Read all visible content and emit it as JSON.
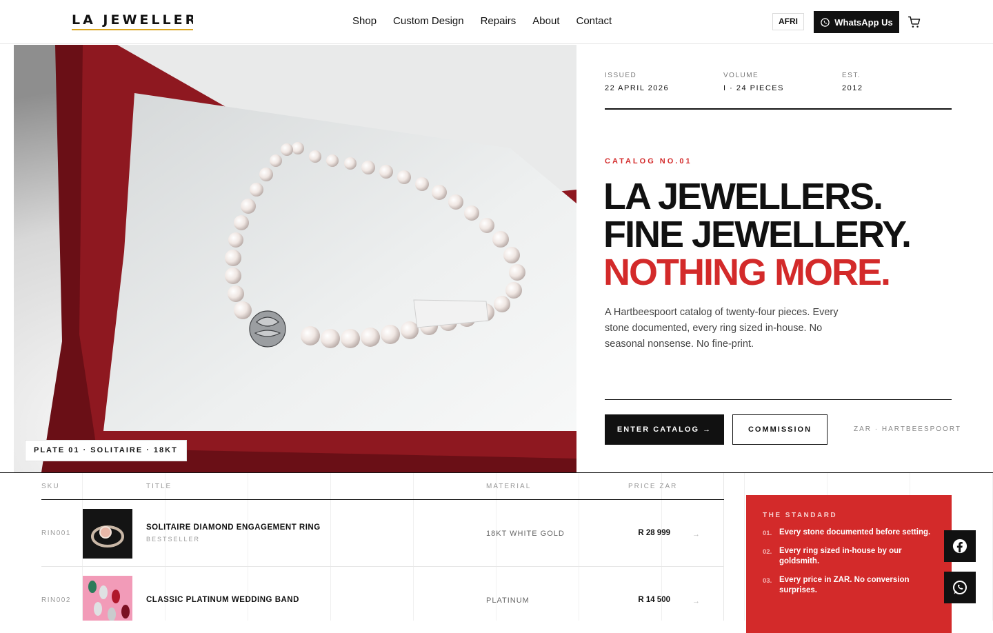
{
  "header": {
    "logo": "LA JEWELLERS",
    "nav": [
      "Shop",
      "Custom Design",
      "Repairs",
      "About",
      "Contact"
    ],
    "language": "AFRI",
    "whatsapp_label": "WhatsApp Us",
    "cart_icon": "cart-icon"
  },
  "hero": {
    "plate_label": "PLATE 01 · SOLITAIRE · 18KT",
    "meta": [
      {
        "key": "ISSUED",
        "value": "22 APRIL 2026"
      },
      {
        "key": "VOLUME",
        "value": "I · 24 PIECES"
      },
      {
        "key": "EST.",
        "value": "2012"
      }
    ],
    "eyebrow": "CATALOG NO.01",
    "headline_line1": "LA JEWELLERS.",
    "headline_line2": "FINE JEWELLERY.",
    "headline_line3": "NOTHING MORE.",
    "lede": "A Hartbeespoort catalog of twenty-four pieces. Every stone documented, every ring sized in-house. No seasonal nonsense. No fine-print.",
    "primary_cta": "ENTER CATALOG →",
    "secondary_cta": "COMMISSION",
    "locale": "ZAR · HARTBEESPOORT"
  },
  "catalog": {
    "columns": {
      "sku": "SKU",
      "title": "TITLE",
      "material": "MATERIAL",
      "price": "PRICE ZAR"
    },
    "rows": [
      {
        "sku": "RIN001",
        "title": "SOLITAIRE DIAMOND ENGAGEMENT RING",
        "subtitle": "BESTSELLER",
        "material": "18KT WHITE GOLD",
        "price": "R 28 999",
        "arrow": "→"
      },
      {
        "sku": "RIN002",
        "title": "CLASSIC PLATINUM WEDDING BAND",
        "subtitle": "",
        "material": "PLATINUM",
        "price": "R 14 500",
        "arrow": "→"
      }
    ]
  },
  "standard": {
    "title": "THE STANDARD",
    "items": [
      {
        "num": "01.",
        "text": "Every stone documented before setting."
      },
      {
        "num": "02.",
        "text": "Every ring sized in-house by our goldsmith."
      },
      {
        "num": "03.",
        "text": "Every price in ZAR. No conversion surprises."
      }
    ]
  },
  "floating": {
    "facebook_icon": "facebook-icon",
    "whatsapp_icon": "whatsapp-icon"
  },
  "colors": {
    "accent_red": "#d32a2a",
    "ink": "#111111",
    "logo_underline": "#d9a521"
  }
}
